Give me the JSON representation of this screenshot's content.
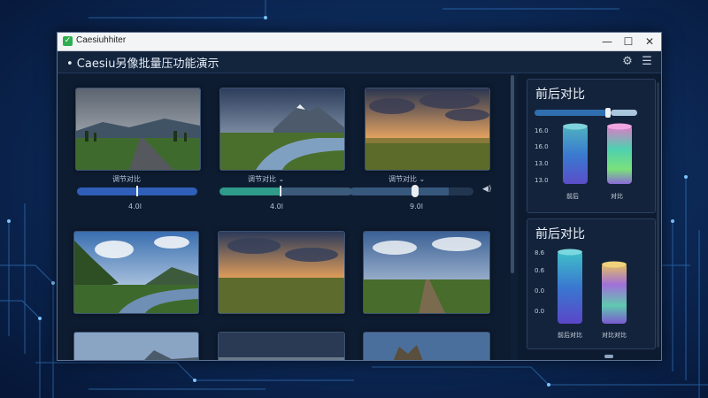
{
  "window": {
    "title": "Caesiuhhiter"
  },
  "toolbar": {
    "app_title": "• Caesiu另像批量压功能演示",
    "settings_icon": "gear-icon",
    "menu_icon": "hamburger-icon"
  },
  "sliders": [
    {
      "label": "调节对比",
      "value_label": "4.0l",
      "value": 0.45,
      "color": "#2f5fb8",
      "chevron": ""
    },
    {
      "label": "调节对比",
      "value_label": "4.0l",
      "value": 0.43,
      "color": "#2f9b8a",
      "chevron": "⌄"
    },
    {
      "label": "调节对比",
      "value_label": "9.0l",
      "value": 0.78,
      "color": "#3a5f8a",
      "chevron": "⌄"
    }
  ],
  "cards": [
    {
      "title": "前后对比",
      "axis": [
        "16.0",
        "16.0",
        "13.0",
        "13.0"
      ],
      "labels": [
        "前后",
        "对比"
      ],
      "progress": 0.6
    },
    {
      "title": "前后对比",
      "axis": [
        "8.6",
        "0.6",
        "0.0",
        "0.0"
      ],
      "labels": [
        "前后对比",
        "对比对比"
      ]
    }
  ],
  "colors": {
    "accent": "#2f9b8a",
    "window_bg": "#0f1f36",
    "titlebar": "#f3f4f6"
  }
}
